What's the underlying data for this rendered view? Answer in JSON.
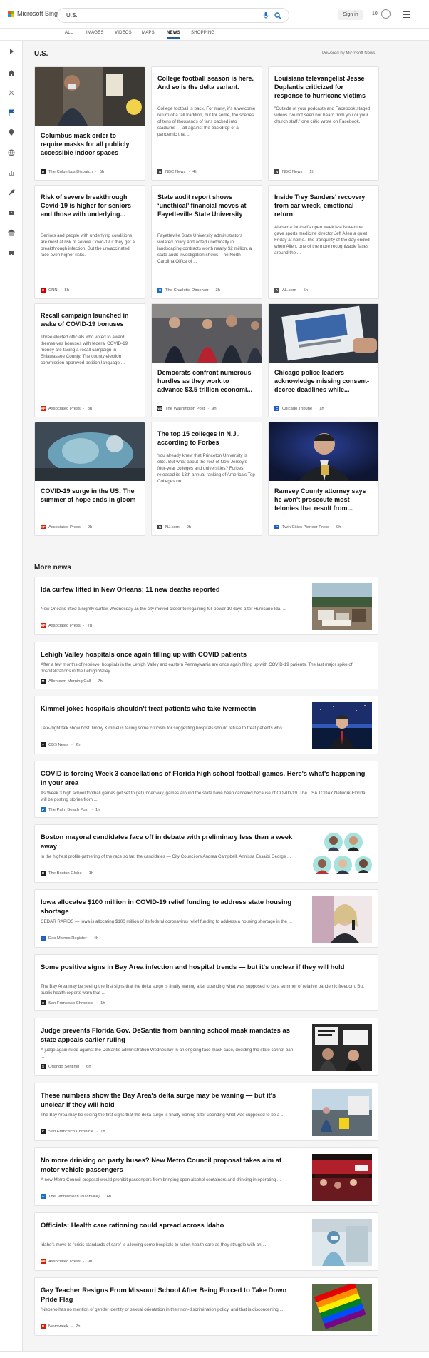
{
  "header": {
    "logo_text": "Microsoft Bing",
    "search_value": "U.S.",
    "signin_label": "Sign in",
    "points": "10"
  },
  "tabs": [
    "ALL",
    "IMAGES",
    "VIDEOS",
    "MAPS",
    "NEWS",
    "SHOPPING"
  ],
  "active_tab": "NEWS",
  "section_title": "U.S.",
  "powered_by": "Powered by Microsoft News",
  "cards": [
    {
      "title": "Columbus mask order to require masks for all publicly accessible indoor spaces",
      "desc": "",
      "source": "The Columbus Dispatch",
      "time": "5h",
      "fav": "D",
      "fav_color": "#222",
      "image": "photo-mask-woman"
    },
    {
      "title": "College football season is here. And so is the delta variant.",
      "desc": "College football is back. For many, it's a welcome return of a fall tradition, but for some, the scenes of tens of thousands of fans packed into stadiums — all against the backdrop of a pandemic that ...",
      "source": "NBC News",
      "time": "4h",
      "fav": "N",
      "fav_color": "#444",
      "image": ""
    },
    {
      "title": "Louisiana televangelist Jesse Duplantis criticized for response to hurricane victims",
      "desc": "\"Outside of your podcasts and Facebook staged videos I've not seen nor heard from you or your church staff,\" one critic wrote on Facebook.",
      "source": "NBC News",
      "time": "1h",
      "fav": "N",
      "fav_color": "#444",
      "image": ""
    },
    {
      "title": "Risk of severe breakthrough Covid-19 is higher for seniors and those with underlying...",
      "desc": "Seniors and people with underlying conditions are most at risk of severe Covid-19 if they get a breakthrough infection. But the unvaccinated face even higher risks.",
      "source": "CNN",
      "time": "5h",
      "fav": "C",
      "fav_color": "#cc0000",
      "image": ""
    },
    {
      "title": "State audit report shows ‘unethical’ financial moves at Fayetteville State University",
      "desc": "Fayetteville State University administrators violated policy and acted unethically in landscaping contracts worth nearly $2 million, a state audit investigation shows. The North Carolina Office of ...",
      "source": "The Charlotte Observer",
      "time": "3h",
      "fav": "C",
      "fav_color": "#1f6fbf",
      "image": ""
    },
    {
      "title": "Inside Trey Sanders' recovery from car wreck, emotional return",
      "desc": "Alabama football's open week last November gave sports medicine director Jeff Allen a quiet Friday at home. The tranquility of the day ended when Allen, one of the more recognizable faces around the ...",
      "source": "AL.com",
      "time": "5h",
      "fav": "A",
      "fav_color": "#555",
      "image": ""
    },
    {
      "title": "Recall campaign launched in wake of COVID-19 bonuses",
      "desc": "Three elected officials who voted to award themselves bonuses with federal COVID-19 money are facing a recall campaign in Shiawassee County. The county election commission approved petition language ...",
      "source": "Associated Press",
      "time": "8h",
      "fav": "AP",
      "fav_color": "#d81e05",
      "image": ""
    },
    {
      "title": "Democrats confront numerous hurdles as they work to advance $3.5 trillion economi...",
      "desc": "",
      "source": "The Washington Post",
      "time": "9h",
      "fav": "wp",
      "fav_color": "#222",
      "image": "photo-democrats"
    },
    {
      "title": "Chicago police leaders acknowledge missing consent-decree deadlines while...",
      "desc": "",
      "source": "Chicago Tribune",
      "time": "1h",
      "fav": "C",
      "fav_color": "#1f5fbf",
      "image": "photo-report"
    },
    {
      "title": "COVID-19 surge in the US: The summer of hope ends in gloom",
      "desc": "",
      "source": "Associated Press",
      "time": "9h",
      "fav": "AP",
      "fav_color": "#d81e05",
      "image": "photo-hospital"
    },
    {
      "title": "The top 15 colleges in N.J., according to Forbes",
      "desc": "You already knew that Princeton University is elite. But what about the rest of New Jersey's four-year colleges and universities? Forbes released its 13th annual ranking of America's Top Colleges on ...",
      "source": "NJ.com",
      "time": "9h",
      "fav": "N",
      "fav_color": "#444",
      "image": ""
    },
    {
      "title": "Ramsey County attorney says he won't prosecute most felonies that result from...",
      "desc": "",
      "source": "Twin Cities Pioneer Press",
      "time": "9h",
      "fav": "P",
      "fav_color": "#1f5fbf",
      "image": "photo-attorney"
    }
  ],
  "more_news_title": "More news",
  "more_news": [
    {
      "title": "Ida curfew lifted in New Orleans; 11 new deaths reported",
      "desc": "New Orleans lifted a nightly curfew Wednesday as the city moved closer to regaining full power 10 days after Hurricane Ida. ...",
      "source": "Associated Press",
      "time": "7h",
      "fav": "AP",
      "fav_color": "#d81e05",
      "thumb": "photo-debris"
    },
    {
      "title": "Lehigh Valley hospitals once again filling up with COVID patients",
      "desc": "After a few months of reprieve, hospitals in the Lehigh Valley and eastern Pennsylvania are once again filling up with COVID-19 patients. The last major spike of hospitalizations in the Lehigh Valley ...",
      "source": "Allentown Morning Call",
      "time": "7h",
      "fav": "M",
      "fav_color": "#222",
      "thumb": ""
    },
    {
      "title": "Kimmel jokes hospitals shouldn't treat patients who take ivermectin",
      "desc": "Late-night talk show host Jimmy Kimmel is facing some criticism for suggesting hospitals should refuse to treat patients who ...",
      "source": "CBS News",
      "time": "2h",
      "fav": "●",
      "fav_color": "#222",
      "thumb": "photo-kimmel"
    },
    {
      "title": "COVID is forcing Week 3 cancellations of Florida high school football games. Here's what's happening in your area",
      "desc": "As Week 3 high school football games get set to get under way, games around the state have been canceled because of COVID-19. The USA TODAY Network-Florida will be posting stories from ...",
      "source": "The Palm Beach Post",
      "time": "1h",
      "fav": "P",
      "fav_color": "#1f6fbf",
      "thumb": ""
    },
    {
      "title": "Boston mayoral candidates face off in debate with preliminary less than a week away",
      "desc": "In the highest profile gathering of the race so far, the candidates — City Councilors Andrea Campbell, Annissa Essaibi George ...",
      "source": "The Boston Globe",
      "time": "1h",
      "fav": "B",
      "fav_color": "#222",
      "thumb": "photo-candidates"
    },
    {
      "title": "Iowa allocates $100 million in COVID-19 relief funding to address state housing shortage",
      "desc": "CEDAR RAPIDS — Iowa is allocating $100 million of its federal coronavirus relief funding to address a housing shortage in the ...",
      "source": "Des Moines Register",
      "time": "4h",
      "fav": "●",
      "fav_color": "#1f5fbf",
      "thumb": "photo-governor"
    },
    {
      "title": "Some positive signs in Bay Area infection and hospital trends — but it's unclear if they will hold",
      "desc": "The Bay Area may be seeing the first signs that the delta surge is finally waning after upending what was supposed to be a summer of relative pandemic freedom. But public health experts warn that ...",
      "source": "San Francisco Chronicle",
      "time": "1h",
      "fav": "C",
      "fav_color": "#222",
      "thumb": ""
    },
    {
      "title": "Judge prevents Florida Gov. DeSantis from banning school mask mandates as state appeals earlier ruling",
      "desc": "A judge again ruled against the DeSantis administration Wednesday in an ongoing face mask case, deciding the state cannot ban ...",
      "source": "Orlando Sentinel",
      "time": "6h",
      "fav": "S",
      "fav_color": "#222",
      "thumb": "photo-protest"
    },
    {
      "title": "These numbers show the Bay Area's delta surge may be waning — but it's unclear if they will hold",
      "desc": "The Bay Area may be seeing the first signs that the delta surge is finally waning after upending what was supposed to be a ...",
      "source": "San Francisco Chronicle",
      "time": "1h",
      "fav": "C",
      "fav_color": "#222",
      "thumb": "photo-testing"
    },
    {
      "title": "No more drinking on party buses? New Metro Council proposal takes aim at motor vehicle passengers",
      "desc": "A new Metro Council proposal would prohibit passengers from bringing open alcohol containers and drinking in operating ...",
      "source": "The Tennessean (Nashville)",
      "time": "6h",
      "fav": "●",
      "fav_color": "#1f6fbf",
      "thumb": "photo-partybus"
    },
    {
      "title": "Officials: Health care rationing could spread across Idaho",
      "desc": "Idaho's move to \"crisis standards of care\" is allowing some hospitals to ration health care as they struggle with an ...",
      "source": "Associated Press",
      "time": "9h",
      "fav": "AP",
      "fav_color": "#d81e05",
      "thumb": "photo-icu"
    },
    {
      "title": "Gay Teacher Resigns From Missouri School After Being Forced to Take Down Pride Flag",
      "desc": "\"Neosho has no mention of gender identity or sexual orientation in their non-discrimination policy, and that is disconcerting ...",
      "source": "Newsweek",
      "time": "2h",
      "fav": "N",
      "fav_color": "#d81e05",
      "thumb": "photo-flags"
    }
  ]
}
